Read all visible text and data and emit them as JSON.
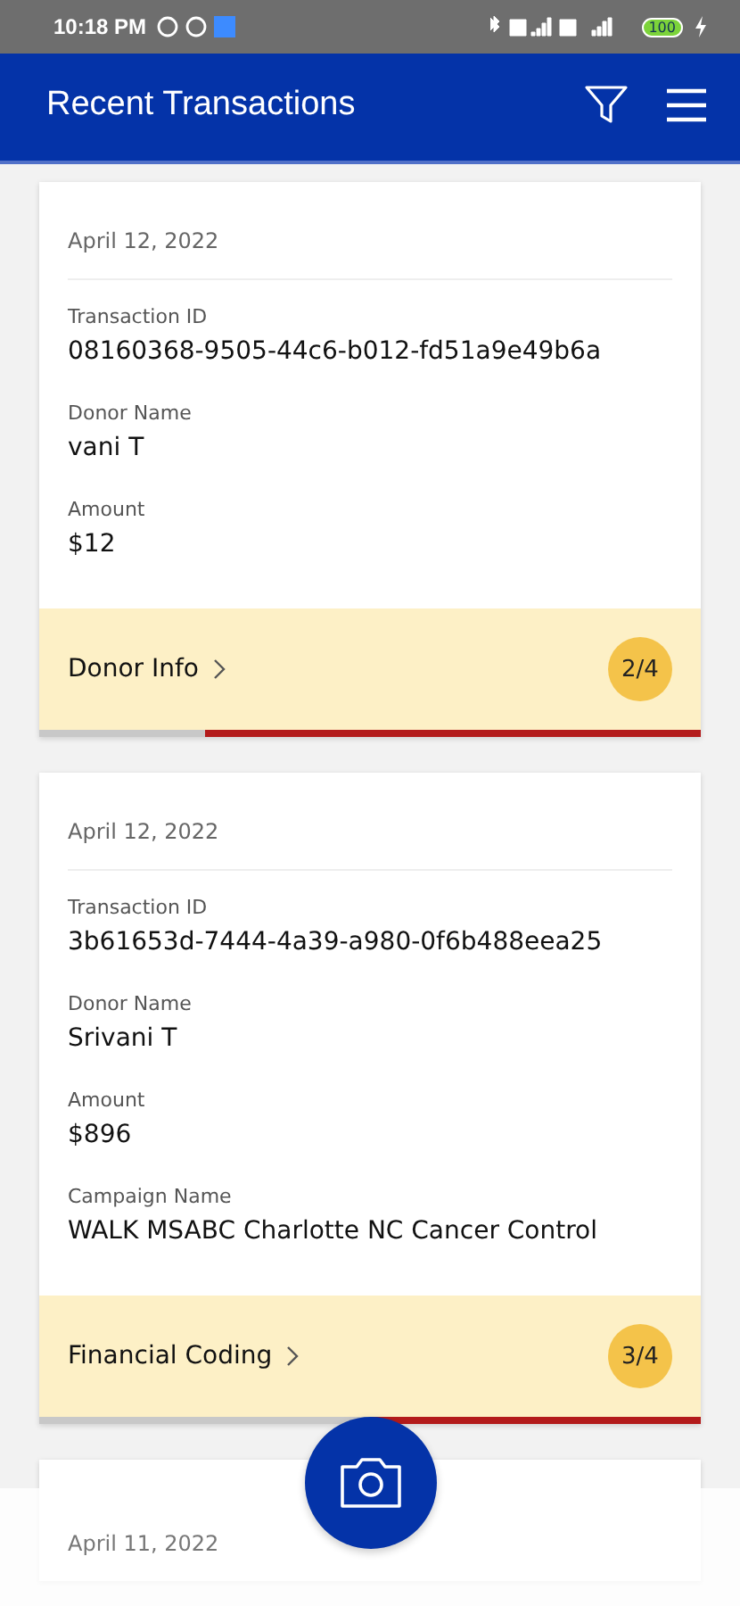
{
  "status_bar": {
    "time": "10:18 PM",
    "battery": "100"
  },
  "header": {
    "title": "Recent Transactions"
  },
  "transactions": [
    {
      "date": "April 12, 2022",
      "fields": [
        {
          "label": "Transaction ID",
          "value": "08160368-9505-44c6-b012-fd51a9e49b6a"
        },
        {
          "label": "Donor Name",
          "value": "vani T"
        },
        {
          "label": "Amount",
          "value": "$12"
        }
      ],
      "step": "Donor Info",
      "progress": "2/4",
      "level": 0.75
    },
    {
      "date": "April 12, 2022",
      "fields": [
        {
          "label": "Transaction ID",
          "value": "3b61653d-7444-4a39-a980-0f6b488eea25"
        },
        {
          "label": "Donor Name",
          "value": "Srivani T"
        },
        {
          "label": "Amount",
          "value": "$896"
        },
        {
          "label": "Campaign Name",
          "value": "WALK MSABC Charlotte NC Cancer Control"
        }
      ],
      "step": "Financial Coding",
      "progress": "3/4",
      "level": 0.5
    },
    {
      "date": "April 11, 2022"
    }
  ]
}
